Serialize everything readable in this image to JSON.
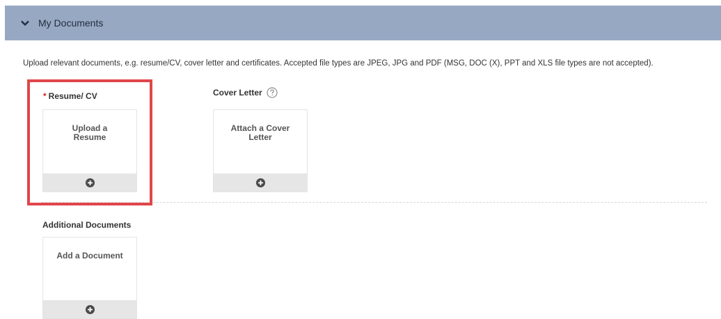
{
  "section": {
    "title": "My Documents",
    "intro": "Upload relevant documents, e.g. resume/CV, cover letter and certificates. Accepted file types are JPEG, JPG and PDF (MSG, DOC (X), PPT and XLS file types are not accepted)."
  },
  "resume": {
    "required_mark": "*",
    "label": "Resume/ CV",
    "tile_text": "Upload a Resume"
  },
  "cover_letter": {
    "label": "Cover Letter",
    "tile_text": "Attach a Cover Letter"
  },
  "additional": {
    "label": "Additional Documents",
    "tile_text": "Add a Document"
  },
  "colors": {
    "header_bg": "#97a8c2",
    "highlight": "#e0464a",
    "required": "#d0271d"
  },
  "icons": {
    "collapse": "chevron-down-icon",
    "help": "help-icon",
    "add": "plus-circle-icon"
  }
}
